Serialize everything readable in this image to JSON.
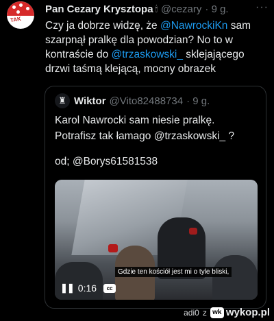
{
  "tweet": {
    "author_name": "Pan Cezary Krysztopa",
    "author_badge": "🕯",
    "author_handle": "@cezary",
    "time": "· 9 g.",
    "more": "···",
    "text_part1": "Czy ja dobrze widzę, że ",
    "mention1": "@NawrockiKn",
    "text_part2": " sam szarpnął pralkę dla powodzian? No to w kontraście do ",
    "mention2": "@trzaskowski_",
    "text_part3": " sklejającego drzwi taśmą klejącą, mocny obrazek",
    "avatar_text": "TAK"
  },
  "quote": {
    "author_name": "Wiktor",
    "author_handle": "@Vito82488734",
    "time": "· 9 g.",
    "avatar_icon": "♜",
    "line1": "Karol Nawrocki sam niesie pralkę.",
    "line2": "Potrafisz tak łamago @trzaskowski_ ?",
    "line3": "od; @Borys61581538",
    "video": {
      "subtitle": "Gdzie ten kościół jest mi o tyle bliski,",
      "pause_icon": "❚❚",
      "time": "0:16",
      "cc_label": "cc"
    }
  },
  "footer": {
    "user": "adi0",
    "z": "z",
    "logo_icon": "wk",
    "site": "wykop.pl"
  }
}
